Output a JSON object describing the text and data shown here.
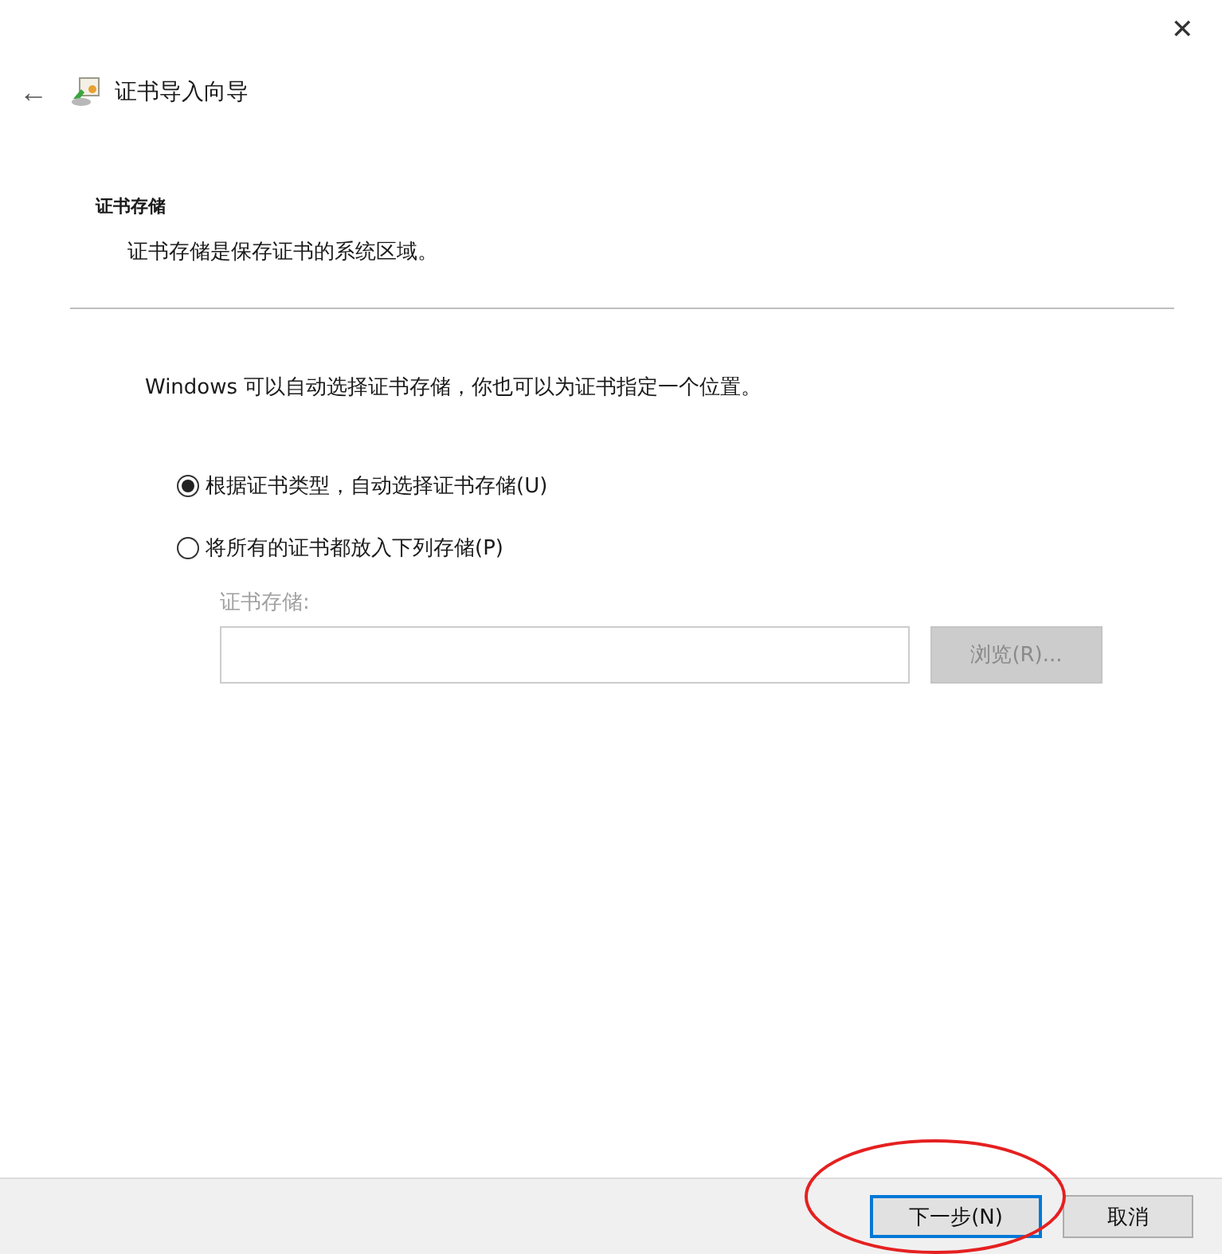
{
  "window": {
    "title": "证书导入向导",
    "close": "✕",
    "back": "←"
  },
  "section": {
    "title": "证书存储",
    "subtitle": "证书存储是保存证书的系统区域。"
  },
  "intro": "Windows 可以自动选择证书存储，你也可以为证书指定一个位置。",
  "options": [
    {
      "label": "根据证书类型，自动选择证书存储(U)",
      "selected": true
    },
    {
      "label": "将所有的证书都放入下列存储(P)",
      "selected": false
    }
  ],
  "store_field": {
    "label": "证书存储:",
    "disabled": true
  },
  "browse_button": {
    "label": "浏览(R)...",
    "disabled": true
  },
  "buttons": [
    {
      "label": "下一步(N)",
      "default": true
    },
    {
      "label": "取消",
      "default": false
    }
  ],
  "annotation": {
    "kind": "ellipse"
  }
}
